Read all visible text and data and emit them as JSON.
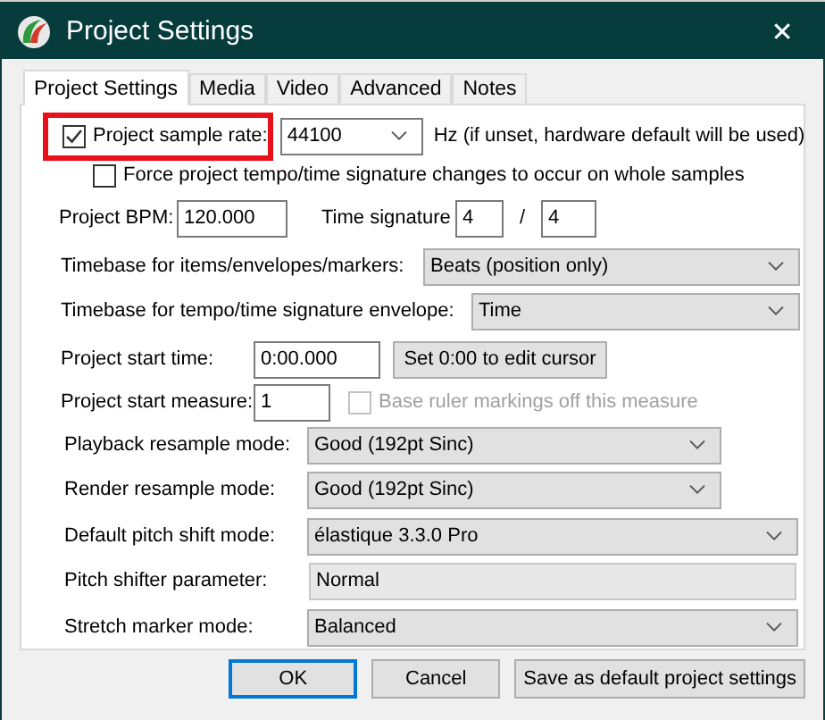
{
  "window": {
    "title": "Project Settings",
    "close": "✕"
  },
  "tabs": [
    {
      "label": "Project Settings",
      "selected": true
    },
    {
      "label": "Media",
      "selected": false
    },
    {
      "label": "Video",
      "selected": false
    },
    {
      "label": "Advanced",
      "selected": false
    },
    {
      "label": "Notes",
      "selected": false
    }
  ],
  "rows": [
    {
      "items": [
        {
          "kind": "checkbox",
          "label": "Project sample rate:",
          "checked": true,
          "disabled": false,
          "highlighted": true
        },
        {
          "kind": "combo",
          "value": "44100"
        },
        {
          "kind": "label",
          "text": "Hz (if unset, hardware default will be used)"
        }
      ]
    },
    {
      "items": [
        {
          "kind": "checkbox",
          "label": "Force project tempo/time signature changes to occur on whole samples",
          "checked": false,
          "disabled": false,
          "highlighted": false
        }
      ]
    },
    {
      "items": [
        {
          "kind": "label",
          "text": "Project BPM:"
        },
        {
          "kind": "input",
          "value": "120.000",
          "disabled": false
        },
        {
          "kind": "label",
          "text": "Time signature"
        },
        {
          "kind": "input",
          "value": "4",
          "disabled": false
        },
        {
          "kind": "label",
          "text": "/"
        },
        {
          "kind": "input",
          "value": "4",
          "disabled": false
        }
      ]
    },
    {
      "items": [
        {
          "kind": "label",
          "text": "Timebase for items/envelopes/markers:"
        },
        {
          "kind": "select",
          "value": "Beats (position only)"
        }
      ]
    },
    {
      "items": [
        {
          "kind": "label",
          "text": "Timebase for tempo/time signature envelope:"
        },
        {
          "kind": "select",
          "value": "Time"
        }
      ]
    },
    {
      "items": [
        {
          "kind": "label",
          "text": "Project start time:"
        },
        {
          "kind": "input",
          "value": "0:00.000",
          "disabled": false
        },
        {
          "kind": "button",
          "label": "Set 0:00 to edit cursor"
        }
      ]
    },
    {
      "items": [
        {
          "kind": "label",
          "text": "Project start measure:"
        },
        {
          "kind": "input",
          "value": "1",
          "disabled": false
        },
        {
          "kind": "checkbox",
          "label": "Base ruler markings off this measure",
          "checked": false,
          "disabled": true,
          "highlighted": false
        }
      ]
    },
    {
      "items": [
        {
          "kind": "label",
          "text": "Playback resample mode:"
        },
        {
          "kind": "select",
          "value": "Good (192pt Sinc)"
        }
      ]
    },
    {
      "items": [
        {
          "kind": "label",
          "text": "Render resample mode:"
        },
        {
          "kind": "select",
          "value": "Good (192pt Sinc)"
        }
      ]
    },
    {
      "items": [
        {
          "kind": "label",
          "text": "Default pitch shift mode:"
        },
        {
          "kind": "select",
          "value": "élastique 3.3.0 Pro"
        }
      ]
    },
    {
      "items": [
        {
          "kind": "label",
          "text": "Pitch shifter parameter:"
        },
        {
          "kind": "input",
          "value": "Normal",
          "disabled": true
        }
      ]
    },
    {
      "items": [
        {
          "kind": "label",
          "text": "Stretch marker mode:"
        },
        {
          "kind": "select",
          "value": "Balanced"
        }
      ]
    }
  ],
  "buttons": [
    {
      "label": "OK",
      "default": true
    },
    {
      "label": "Cancel",
      "default": false
    },
    {
      "label": "Save as default project settings",
      "default": false
    }
  ]
}
